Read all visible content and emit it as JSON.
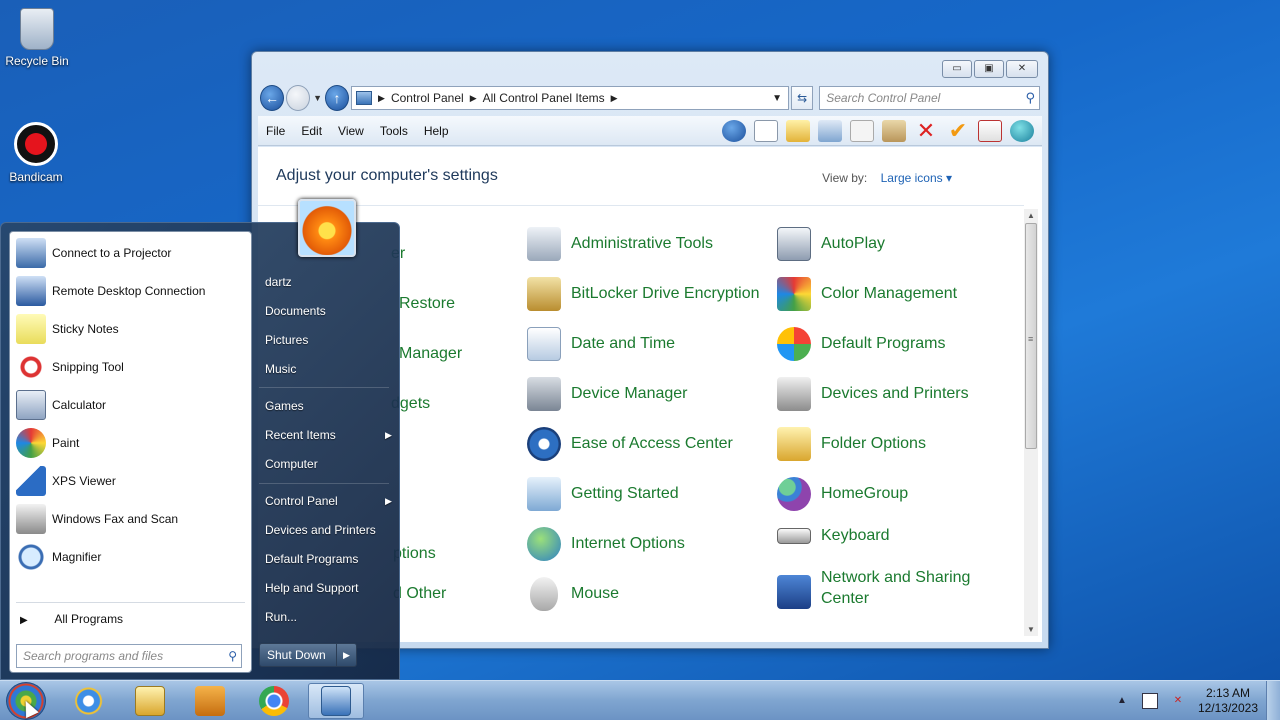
{
  "desktop": {
    "icons": [
      {
        "label": "Recycle Bin"
      },
      {
        "label": "Bandicam"
      }
    ]
  },
  "window": {
    "address": {
      "segments": [
        "Control Panel",
        "All Control Panel Items"
      ]
    },
    "search_placeholder": "Search Control Panel",
    "menu": [
      "File",
      "Edit",
      "View",
      "Tools",
      "Help"
    ],
    "heading": "Adjust your computer's settings",
    "view_by_label": "View by:",
    "view_by_value": "Large icons",
    "items": [
      {
        "label": "Administrative Tools"
      },
      {
        "label": "AutoPlay"
      },
      {
        "label": "BitLocker Drive Encryption"
      },
      {
        "label": "Color Management"
      },
      {
        "label": "Date and Time"
      },
      {
        "label": "Default Programs"
      },
      {
        "label": "Device Manager"
      },
      {
        "label": "Devices and Printers"
      },
      {
        "label": "Ease of Access Center"
      },
      {
        "label": "Folder Options"
      },
      {
        "label": "Getting Started"
      },
      {
        "label": "HomeGroup"
      },
      {
        "label": "Internet Options"
      },
      {
        "label": "Keyboard"
      },
      {
        "label": "Mouse"
      },
      {
        "label": "Network and Sharing Center"
      }
    ],
    "partial_items": [
      "er",
      "Restore",
      "Manager",
      "dgets",
      "ptions",
      "d Other"
    ]
  },
  "start_menu": {
    "programs": [
      {
        "label": "Connect to a Projector",
        "icon": "projector-icon"
      },
      {
        "label": "Remote Desktop Connection",
        "icon": "remote-desktop-icon"
      },
      {
        "label": "Sticky Notes",
        "icon": "sticky-notes-icon"
      },
      {
        "label": "Snipping Tool",
        "icon": "snipping-tool-icon"
      },
      {
        "label": "Calculator",
        "icon": "calculator-icon"
      },
      {
        "label": "Paint",
        "icon": "paint-icon"
      },
      {
        "label": "XPS Viewer",
        "icon": "xps-viewer-icon"
      },
      {
        "label": "Windows Fax and Scan",
        "icon": "fax-scan-icon"
      },
      {
        "label": "Magnifier",
        "icon": "magnifier-icon"
      }
    ],
    "all_programs": "All Programs",
    "search_placeholder": "Search programs and files",
    "right": {
      "user": "dartz",
      "documents": "Documents",
      "pictures": "Pictures",
      "music": "Music",
      "games": "Games",
      "recent_items": "Recent Items",
      "computer": "Computer",
      "control_panel": "Control Panel",
      "devices_printers": "Devices and Printers",
      "default_programs": "Default Programs",
      "help_support": "Help and Support",
      "run": "Run..."
    },
    "shutdown": "Shut Down"
  },
  "taskbar": {
    "time": "2:13 AM",
    "date": "12/13/2023"
  }
}
